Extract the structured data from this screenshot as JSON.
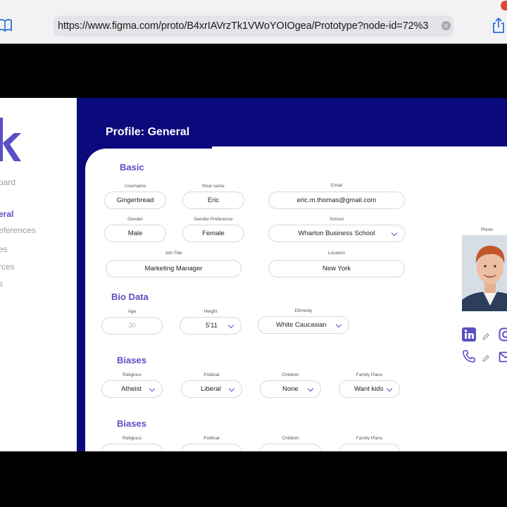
{
  "browser": {
    "url": "https://www.figma.com/proto/B4xrIAVrzTk1VWoYOIOgea/Prototype?node-id=72%3"
  },
  "sidebar": {
    "items": [
      {
        "label": "oard",
        "active": false
      },
      {
        "label": "eral",
        "active": true
      },
      {
        "label": "eferences",
        "active": false
      },
      {
        "label": "es",
        "active": false
      },
      {
        "label": "rces",
        "active": false
      },
      {
        "label": "s",
        "active": false
      }
    ]
  },
  "page": {
    "title": "Profile: General"
  },
  "basic": {
    "heading": "Basic",
    "username": {
      "label": "Username",
      "value": "Gingerbread"
    },
    "real_name": {
      "label": "Real name",
      "value": "Eric"
    },
    "email": {
      "label": "Email",
      "value": "eric.m.thomas@gmail.com"
    },
    "gender": {
      "label": "Gender",
      "value": "Male"
    },
    "gender_pref": {
      "label": "Gender Preference",
      "value": "Female"
    },
    "school": {
      "label": "School",
      "value": "Wharton Business School"
    },
    "job_title": {
      "label": "Job Title",
      "value": "Marketing Manager"
    },
    "location": {
      "label": "Location",
      "value": "New York"
    }
  },
  "bio": {
    "heading": "Bio Data",
    "age": {
      "label": "Age",
      "value": "30"
    },
    "height": {
      "label": "Height",
      "value": "5'11"
    },
    "ethnicity": {
      "label": "Ethnicity",
      "value": "White Caucasian"
    }
  },
  "biases": {
    "heading": "Biases",
    "religious": {
      "label": "Religious",
      "value": "Atheist"
    },
    "political": {
      "label": "Political",
      "value": "Liberal"
    },
    "children": {
      "label": "Children",
      "value": "None"
    },
    "family_plans": {
      "label": "Family Plans",
      "value": "Want kids"
    }
  },
  "biases2": {
    "heading": "Biases",
    "religious": {
      "label": "Religious"
    },
    "political": {
      "label": "Political"
    },
    "children": {
      "label": "Children"
    },
    "family_plans": {
      "label": "Family Plans"
    }
  },
  "photo": {
    "label": "Photo"
  },
  "colors": {
    "navy": "#0a0a7c",
    "accent": "#5a4fc4"
  }
}
